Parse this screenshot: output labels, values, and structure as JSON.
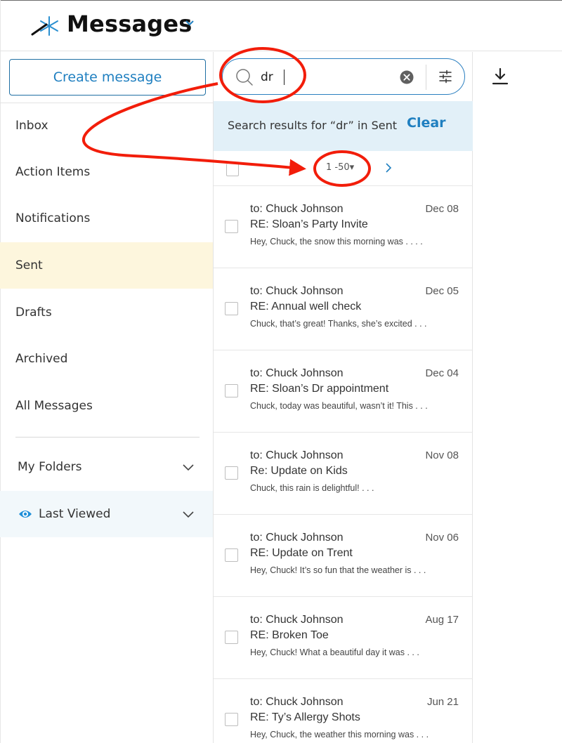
{
  "header": {
    "title": "Messages",
    "logo_icon": "snowflake-logo-icon",
    "chevron_icon": "chevron-down-icon"
  },
  "sidebar": {
    "create_label": "Create message",
    "items": [
      {
        "label": "Inbox"
      },
      {
        "label": "Action Items"
      },
      {
        "label": "Notifications"
      },
      {
        "label": "Sent",
        "active": true
      },
      {
        "label": "Drafts"
      },
      {
        "label": "Archived"
      },
      {
        "label": "All Messages"
      }
    ],
    "my_folders": "My Folders",
    "last_viewed": "Last Viewed"
  },
  "search": {
    "value": "dr",
    "results_text": "Search results for “dr” in Sent",
    "clear_label": "Clear"
  },
  "pager": {
    "range": "1 -50"
  },
  "messages": [
    {
      "to_prefix": "to:",
      "to": " Chuck Johnson",
      "date": "Dec 08",
      "subject": "RE: Sloan’s Party Invite",
      "preview": "Hey, Chuck, the snow this morning was . . .       ."
    },
    {
      "to_prefix": "to:",
      "to": " Chuck Johnson",
      "date": "Dec 05",
      "subject": "RE: Annual well check",
      "preview": "Chuck, that’s great! Thanks, she’s excited . . ."
    },
    {
      "to_prefix": "to:",
      "to": " Chuck Johnson",
      "date": "Dec 04",
      "subject": "RE: Sloan’s Dr appointment",
      "preview": "Chuck, today was beautiful, wasn’t it! This . . ."
    },
    {
      "to_prefix": "to:",
      "to": " Chuck Johnson",
      "date": "Nov 08",
      "subject": "Re: Update on Kids",
      "preview": "Chuck, this rain is delightful!  . . ."
    },
    {
      "to_prefix": "to:",
      "to": " Chuck Johnson",
      "date": "Nov 06",
      "subject": "RE: Update on Trent",
      "preview": "Hey, Chuck! It’s so fun that the weather is . . ."
    },
    {
      "to_prefix": "to:",
      "to": " Chuck Johnson",
      "date": "Aug 17",
      "subject": "RE: Broken Toe",
      "preview": "Hey, Chuck! What a beautiful day it was . . ."
    },
    {
      "to_prefix": "to:",
      "to": " Chuck Johnson",
      "date": "Jun 21",
      "subject": "RE: Ty’s Allergy Shots",
      "preview": "Hey, Chuck, the weather this morning was . . ."
    }
  ],
  "colors": {
    "accent": "#1f7fc0",
    "active_row": "#fdf6dd",
    "results_bar": "#e2f0f8",
    "annotation": "#f21d0a"
  }
}
